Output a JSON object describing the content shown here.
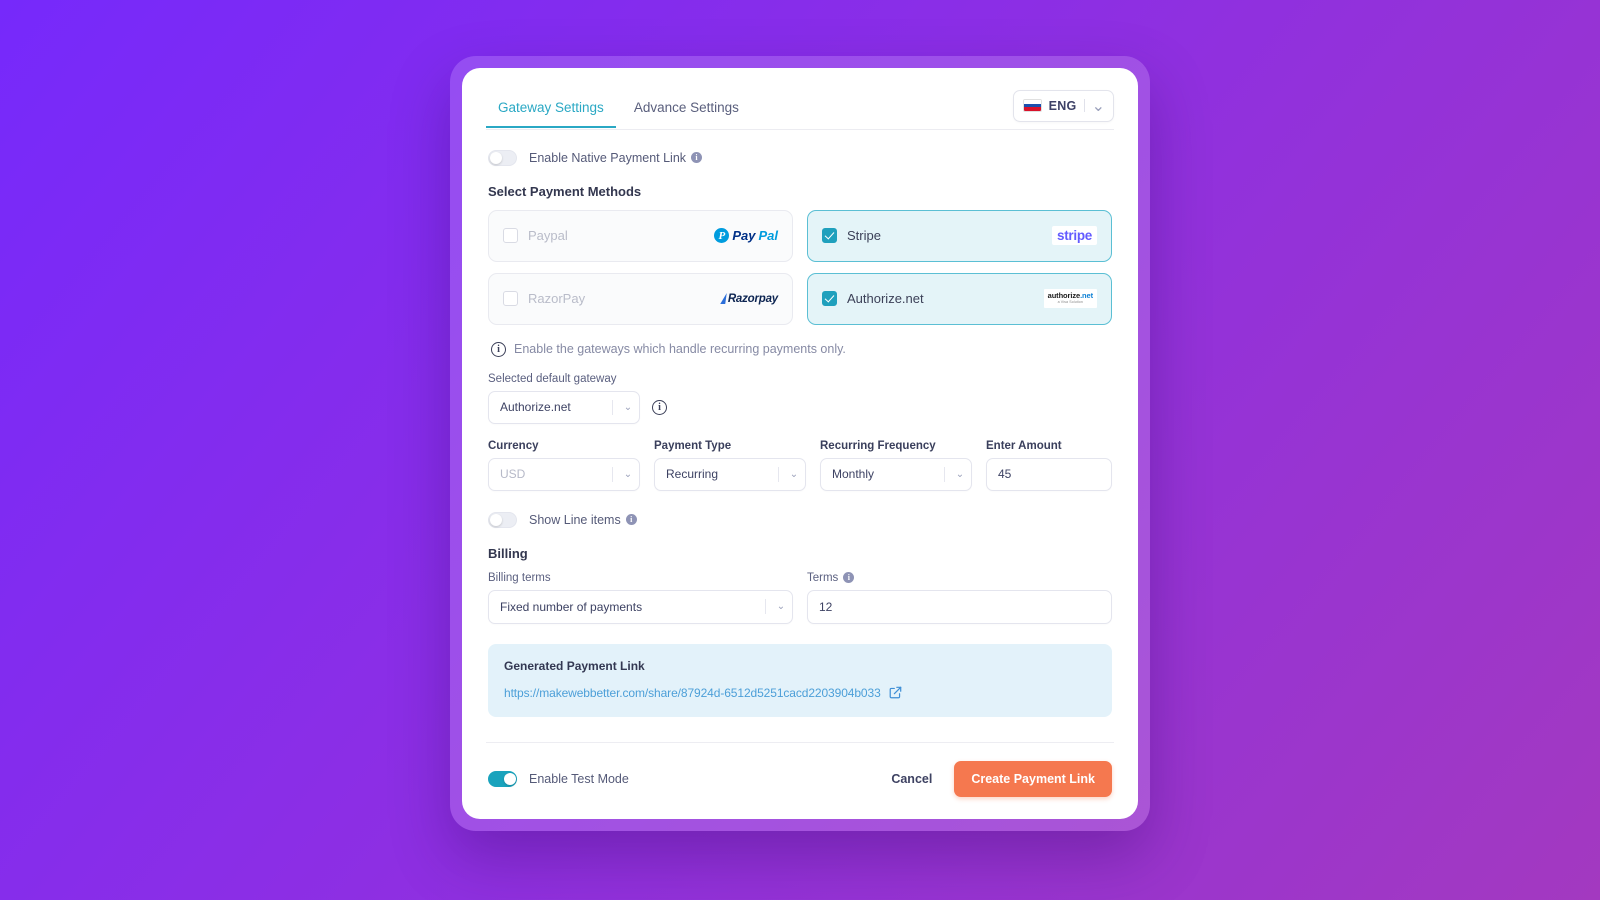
{
  "header": {
    "tabs": [
      {
        "label": "Gateway Settings",
        "active": true
      },
      {
        "label": "Advance Settings",
        "active": false
      }
    ],
    "language": {
      "code": "ENG",
      "flag": "russia-flag-icon",
      "caret": "⌄"
    }
  },
  "native_link_toggle": {
    "label": "Enable Native Payment Link",
    "on": false,
    "info": "i"
  },
  "payment_methods": {
    "section_title": "Select Payment Methods",
    "items": [
      {
        "name": "Paypal",
        "selected": false,
        "logo": "paypal-logo"
      },
      {
        "name": "Stripe",
        "selected": true,
        "logo": "stripe-logo"
      },
      {
        "name": "RazorPay",
        "selected": false,
        "logo": "razorpay-logo"
      },
      {
        "name": "Authorize.net",
        "selected": true,
        "logo": "authorizenet-logo"
      }
    ],
    "hint": "Enable the gateways which handle recurring payments only."
  },
  "default_gateway": {
    "label": "Selected default gateway",
    "value": "Authorize.net",
    "caret": "⌄",
    "info": "i"
  },
  "fields": {
    "currency": {
      "label": "Currency",
      "value": "USD",
      "muted": true,
      "caret": "⌄"
    },
    "payment_type": {
      "label": "Payment Type",
      "value": "Recurring",
      "muted": false,
      "caret": "⌄"
    },
    "frequency": {
      "label": "Recurring Frequency",
      "value": "Monthly",
      "muted": false,
      "caret": "⌄"
    },
    "amount": {
      "label": "Enter Amount",
      "value": "45"
    }
  },
  "line_items_toggle": {
    "label": "Show Line items",
    "on": false,
    "info": "i"
  },
  "billing": {
    "section_title": "Billing",
    "terms_select": {
      "label": "Billing terms",
      "value": "Fixed number of payments",
      "caret": "⌄"
    },
    "terms_input": {
      "label": "Terms",
      "value": "12",
      "info": "i"
    }
  },
  "generated_link": {
    "title": "Generated Payment Link",
    "url": "https://makewebbetter.com/share/87924d-6512d5251cacd2203904b033",
    "external_icon": "external-link-icon"
  },
  "footer": {
    "test_mode": {
      "label": "Enable Test Mode",
      "on": true
    },
    "cancel_label": "Cancel",
    "submit_label": "Create Payment Link"
  },
  "brand": {
    "paypal_mark": "P",
    "paypal_pay": "Pay",
    "paypal_pal": "Pal",
    "stripe_text": "stripe",
    "razorpay_text": "Razorpay",
    "authnet_main": "authorize",
    "authnet_accent": ".net",
    "authnet_sub": "a Visa Solution"
  },
  "colors": {
    "accent_teal": "#1fa0bd",
    "primary_orange": "#f5784f",
    "link_blue": "#4c9fd8",
    "selected_card_bg": "#e4f4f8",
    "gen_box_bg": "#e3f2fa",
    "bg_gradient_start": "#7629FB",
    "bg_gradient_end": "#A339C0"
  }
}
